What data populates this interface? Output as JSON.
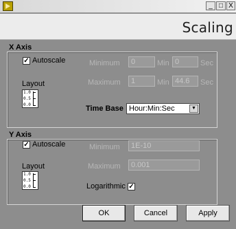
{
  "window": {
    "minimize_glyph": "_",
    "maximize_glyph": "□",
    "close_glyph": "X"
  },
  "header": {
    "title": "Scaling"
  },
  "x_axis": {
    "title": "X Axis",
    "autoscale_label": "Autoscale",
    "autoscale_checked": true,
    "layout_label": "Layout",
    "minimum_label": "Minimum",
    "maximum_label": "Maximum",
    "min_unit": "Min",
    "sec_unit": "Sec",
    "minimum_min_value": "0",
    "minimum_sec_value": "0",
    "maximum_min_value": "1",
    "maximum_sec_value": "44.6",
    "time_base_label": "Time Base",
    "time_base_value": "Hour:Min:Sec"
  },
  "y_axis": {
    "title": "Y Axis",
    "autoscale_label": "Autoscale",
    "autoscale_checked": true,
    "layout_label": "Layout",
    "minimum_label": "Minimum",
    "maximum_label": "Maximum",
    "minimum_value": "1E-10",
    "maximum_value": "0.001",
    "logarithmic_label": "Logarithmic",
    "logarithmic_checked": true
  },
  "layout_icon": {
    "ticks": [
      "1.0",
      "0.5",
      "0.0"
    ]
  },
  "buttons": {
    "ok": "OK",
    "cancel": "Cancel",
    "apply": "Apply"
  },
  "icons": {
    "app": "labview-run-icon",
    "checkmark": "✓",
    "dropdown": "▼"
  }
}
